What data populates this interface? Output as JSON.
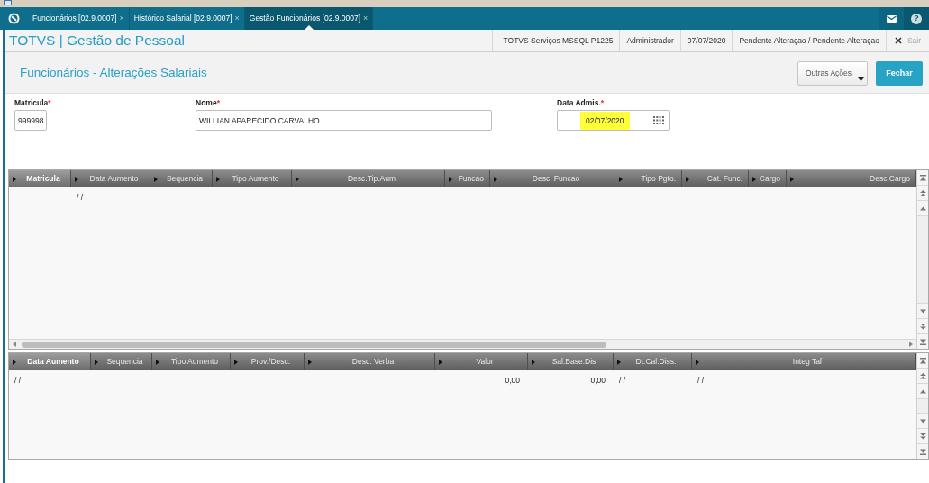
{
  "app_bar": {
    "tabs": [
      {
        "label": "Funcionários [02.9.0007]",
        "close": "×",
        "selected": false
      },
      {
        "label": "Histórico Salarial [02.9.0007]",
        "close": "×",
        "selected": false
      },
      {
        "label": "Gestão Funcionários [02.9.0007]",
        "close": "×",
        "selected": true
      }
    ],
    "help": "?"
  },
  "header": {
    "title": "TOTVS | Gestão de Pessoal",
    "info": [
      "TOTVS Serviços MSSQL P1225",
      "Administrador",
      "07/07/2020",
      "Pendente Alteraçao / Pendente Alteraçao"
    ],
    "exit": {
      "label": "Sair",
      "disabled": true
    }
  },
  "page": {
    "title": "Funcionários - Alterações Salariais",
    "buttons": [
      {
        "label": "Outras Ações",
        "kind": "menu"
      },
      {
        "label": "Fechar",
        "kind": "primary"
      }
    ]
  },
  "form": {
    "fields": [
      {
        "label": "Matricula",
        "required_mark": "*",
        "value": "999998",
        "kind": "text",
        "highlighted": false
      },
      {
        "label": "Nome",
        "required_mark": "*",
        "value": "WILLIAN APARECIDO CARVALHO",
        "kind": "text",
        "highlighted": false
      },
      {
        "label": "Data Admis.",
        "required_mark": "*",
        "value": "02/07/2020",
        "kind": "date",
        "highlighted": true
      }
    ]
  },
  "grids": [
    {
      "columns": [
        {
          "label": "Matricula",
          "selected": true
        },
        {
          "label": "Data Aumento",
          "selected": false,
          "cells": [
            "/ /"
          ]
        },
        {
          "label": "Sequencia",
          "selected": false
        },
        {
          "label": "Tipo Aumento",
          "selected": false
        },
        {
          "label": "Desc.Tip.Aum",
          "selected": false
        },
        {
          "label": "Funcao",
          "selected": false
        },
        {
          "label": "Desc. Funcao",
          "selected": false
        },
        {
          "label": "Tipo Pgto.",
          "selected": false
        },
        {
          "label": "Cat. Func.",
          "selected": false
        },
        {
          "label": "Cargo",
          "selected": false
        },
        {
          "label": "Desc.Cargo",
          "selected": false
        }
      ]
    },
    {
      "columns": [
        {
          "label": "Data Aumento",
          "selected": true,
          "cells": [
            "/ /"
          ]
        },
        {
          "label": "Sequencia",
          "selected": false
        },
        {
          "label": "Tipo Aumento",
          "selected": false
        },
        {
          "label": "Prov./Desc.",
          "selected": false
        },
        {
          "label": "Desc. Verba",
          "selected": false
        },
        {
          "label": "Valor",
          "selected": false,
          "cells": [
            "0,00"
          ]
        },
        {
          "label": "Sal.Base.Dis",
          "selected": false,
          "cells": [
            "0,00"
          ]
        },
        {
          "label": "Dt.Cal.Diss.",
          "selected": false,
          "cells": [
            "/ /"
          ]
        },
        {
          "label": "Integ Taf",
          "selected": false,
          "cells": [
            "/ /"
          ]
        }
      ]
    }
  ]
}
